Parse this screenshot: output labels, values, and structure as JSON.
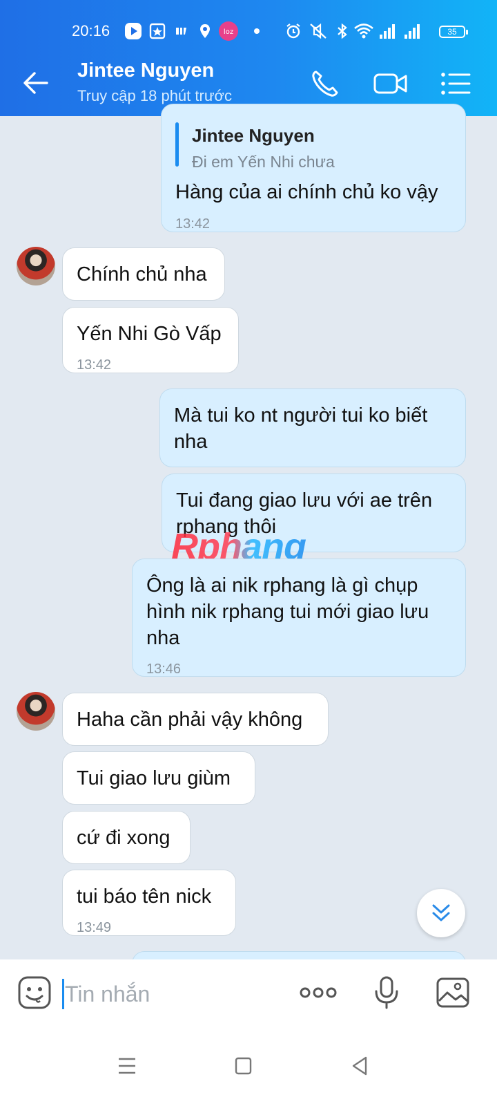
{
  "status_bar": {
    "time": "20:16",
    "battery": "35",
    "icons": [
      "play-icon",
      "star-badge-icon",
      "app-icon",
      "location-icon",
      "heart-app-icon",
      "alarm-icon",
      "mute-icon",
      "bluetooth-icon",
      "wifi-icon",
      "signal-icon",
      "battery-icon"
    ],
    "notification_badge": "loz"
  },
  "header": {
    "name": "Jintee Nguyen",
    "status": "Truy cập 18 phút trước",
    "accent": "#1a8cf0"
  },
  "messages": [
    {
      "direction": "out",
      "quote_name": "Jintee Nguyen",
      "quote_text": "Đi em Yến Nhi chưa",
      "text": "Hàng của ai chính chủ ko vậy",
      "time": "13:42"
    },
    {
      "direction": "in",
      "text": "Chính chủ nha"
    },
    {
      "direction": "in",
      "text": "Yến Nhi Gò Vấp",
      "time": "13:42"
    },
    {
      "direction": "out",
      "lines": [
        "Mà tui ko nt người tui ko biết",
        "nha"
      ]
    },
    {
      "direction": "out",
      "lines": [
        "Tui đang giao lưu với ae trên",
        "rphang thôi"
      ]
    },
    {
      "direction": "out",
      "lines": [
        "Ông là ai nik rphang là gì chụp",
        "hình nik rphang tui mới giao lưu",
        "nha"
      ],
      "time": "13:46"
    },
    {
      "direction": "in",
      "text": "Haha cần phải vậy không"
    },
    {
      "direction": "in",
      "text": "Tui giao lưu giùm"
    },
    {
      "direction": "in",
      "text": "cứ đi xong"
    },
    {
      "direction": "in",
      "text": "tui báo tên nick",
      "time": "13:49"
    }
  ],
  "watermark": "Rphang",
  "input": {
    "placeholder": "Tin nhắn",
    "value": ""
  },
  "colors": {
    "chat_bg": "#e2e9f1",
    "bubble_out": "#d8efff",
    "bubble_in": "#ffffff"
  }
}
